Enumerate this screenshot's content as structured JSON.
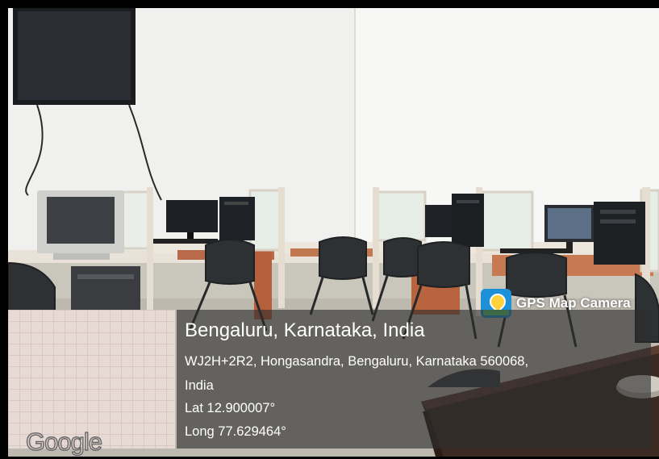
{
  "app_badge": {
    "icon": "gps-map-camera-icon",
    "label": "GPS Map Camera"
  },
  "map_thumbnail": {
    "logo_text": "Google"
  },
  "location": {
    "title": "Bengaluru, Karnataka, India",
    "address_line_1": "WJ2H+2R2, Hongasandra, Bengaluru, Karnataka 560068,",
    "address_line_2": "India",
    "latitude": "Lat 12.900007°",
    "longitude": "Long 77.629464°"
  }
}
